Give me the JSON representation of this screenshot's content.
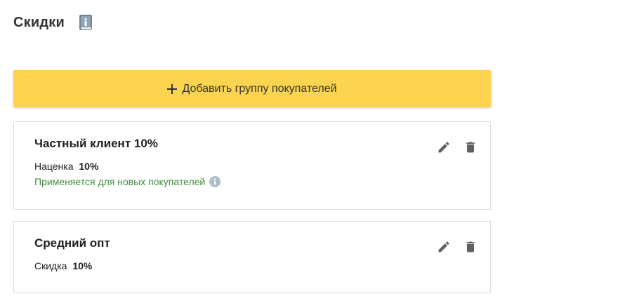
{
  "header": {
    "title": "Скидки",
    "help_icon": "book-info-icon"
  },
  "add_button": {
    "label": "Добавить группу покупателей",
    "icon": "plus-icon",
    "color": "#fdd44f"
  },
  "groups": [
    {
      "title": "Частный клиент 10%",
      "param_label": "Наценка",
      "param_value": "10%",
      "note": "Применяется для новых покупателей",
      "note_color": "#3f8f3f"
    },
    {
      "title": "Средний опт",
      "param_label": "Скидка",
      "param_value": "10%"
    }
  ],
  "actions": {
    "edit_icon": "pencil-icon",
    "delete_icon": "trash-icon",
    "icon_color": "#616161"
  }
}
